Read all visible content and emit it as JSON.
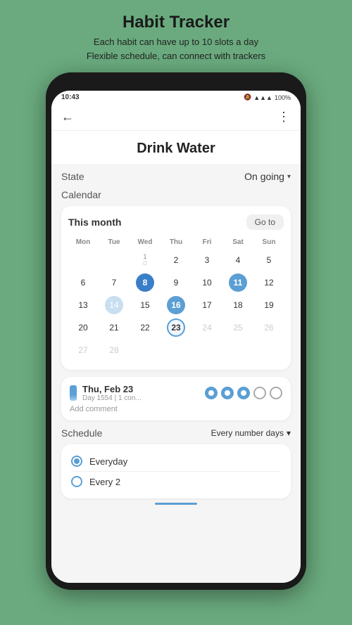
{
  "app_header": {
    "title": "Habit Tracker",
    "subtitle_line1": "Each habit can have up to 10 slots a day",
    "subtitle_line2": "Flexible schedule, can connect with trackers"
  },
  "status_bar": {
    "time": "10:43",
    "battery": "100%"
  },
  "page": {
    "title": "Drink Water"
  },
  "state": {
    "label": "State",
    "value": "On going"
  },
  "calendar": {
    "section_label": "Calendar",
    "month_label": "This month",
    "goto_button": "Go to",
    "day_headers": [
      "Mon",
      "Tue",
      "Wed",
      "Thu",
      "Fri",
      "Sat",
      "Sun"
    ],
    "week1": [
      {
        "num": "",
        "style": "empty"
      },
      {
        "num": "",
        "style": "empty"
      },
      {
        "num": "1/2",
        "style": "wed-special"
      },
      {
        "num": "2",
        "style": "normal"
      },
      {
        "num": "3",
        "style": "normal"
      },
      {
        "num": "4",
        "style": "normal"
      },
      {
        "num": "5",
        "style": "normal"
      }
    ],
    "week2": [
      {
        "num": "6",
        "style": "normal"
      },
      {
        "num": "7",
        "style": "normal"
      },
      {
        "num": "8",
        "style": "filled-dark"
      },
      {
        "num": "9",
        "style": "normal"
      },
      {
        "num": "10",
        "style": "normal"
      },
      {
        "num": "11",
        "style": "filled"
      },
      {
        "num": "12",
        "style": "normal"
      }
    ],
    "week3": [
      {
        "num": "13",
        "style": "normal"
      },
      {
        "num": "14",
        "style": "partial"
      },
      {
        "num": "15",
        "style": "normal"
      },
      {
        "num": "16",
        "style": "filled"
      },
      {
        "num": "17",
        "style": "normal"
      },
      {
        "num": "18",
        "style": "normal"
      },
      {
        "num": "19",
        "style": "normal"
      }
    ],
    "week4": [
      {
        "num": "20",
        "style": "normal"
      },
      {
        "num": "21",
        "style": "normal"
      },
      {
        "num": "22",
        "style": "normal"
      },
      {
        "num": "23",
        "style": "today"
      },
      {
        "num": "24",
        "style": "muted"
      },
      {
        "num": "25",
        "style": "muted"
      },
      {
        "num": "26",
        "style": "muted"
      }
    ],
    "week5": [
      {
        "num": "27",
        "style": "muted"
      },
      {
        "num": "28",
        "style": "muted"
      },
      {
        "num": "",
        "style": "empty"
      },
      {
        "num": "",
        "style": "empty"
      },
      {
        "num": "",
        "style": "empty"
      },
      {
        "num": "",
        "style": "empty"
      },
      {
        "num": "",
        "style": "empty"
      }
    ]
  },
  "date_detail": {
    "date": "Thu, Feb 23",
    "sub": "Day 1554 | 1 con...",
    "dots": [
      {
        "filled": true
      },
      {
        "filled": true
      },
      {
        "filled": true
      },
      {
        "filled": false
      },
      {
        "filled": false
      }
    ],
    "add_comment": "Add comment"
  },
  "schedule": {
    "section_label": "Schedule",
    "value_label": "Every number days",
    "options": [
      {
        "label": "Everyday",
        "selected": true
      },
      {
        "label": "Every 2",
        "selected": false
      }
    ]
  },
  "icons": {
    "back_arrow": "←",
    "menu": "⋮",
    "dropdown_arrow": "▾"
  }
}
